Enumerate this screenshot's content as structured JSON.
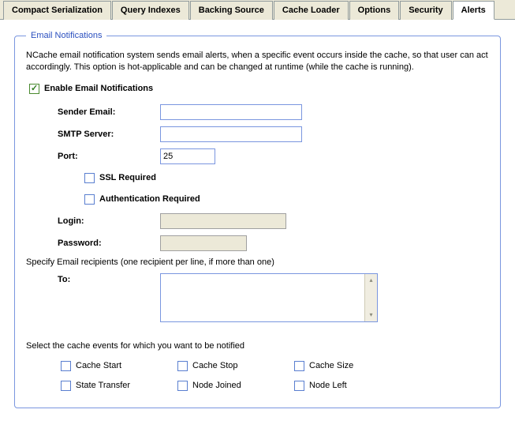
{
  "tabs": {
    "compact": "Compact Serialization",
    "query": "Query Indexes",
    "backing": "Backing Source",
    "loader": "Cache Loader",
    "options": "Options",
    "security": "Security",
    "alerts": "Alerts"
  },
  "fieldset_title": "Email Notifications",
  "description": "NCache email notification system sends email alerts, when a specific event occurs inside the cache, so that user can act accordingly. This option is hot-applicable and can be changed at runtime (while the cache is running).",
  "enable_label": "Enable Email Notifications",
  "form": {
    "sender_label": "Sender Email:",
    "sender_value": "",
    "smtp_label": "SMTP Server:",
    "smtp_value": "",
    "port_label": "Port:",
    "port_value": "25",
    "ssl_label": "SSL Required",
    "auth_label": "Authentication Required",
    "login_label": "Login:",
    "login_value": "",
    "password_label": "Password:",
    "password_value": ""
  },
  "recipients_hint": "Specify Email recipients (one recipient per line, if more than one)",
  "to_label": "To:",
  "to_value": "",
  "events_hint": "Select the cache events for which you want to be notified",
  "events": {
    "cache_start": "Cache Start",
    "cache_stop": "Cache Stop",
    "cache_size": "Cache Size",
    "state_transfer": "State Transfer",
    "node_joined": "Node Joined",
    "node_left": "Node Left"
  }
}
